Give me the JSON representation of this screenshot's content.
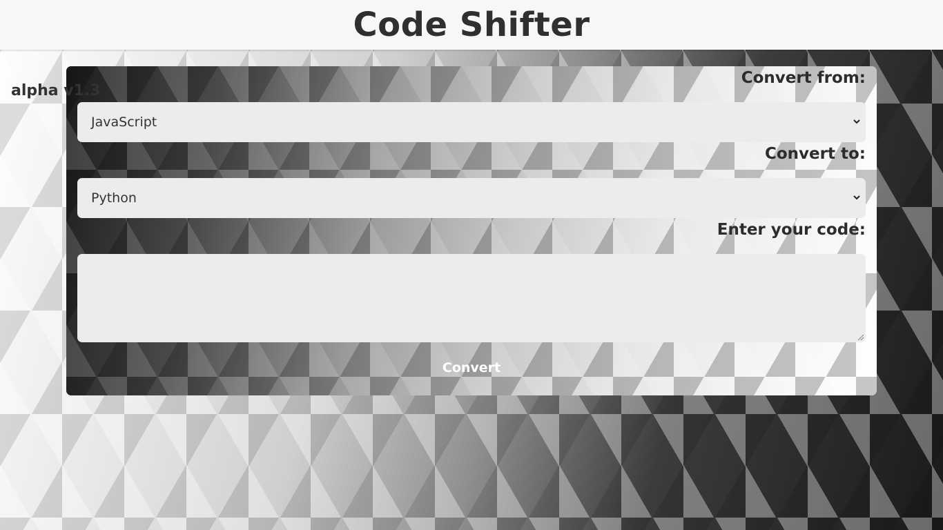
{
  "header": {
    "title": "Code Shifter"
  },
  "version_label": "alpha v1.3",
  "form": {
    "from_label": "Convert from:",
    "from_value": "JavaScript",
    "to_label": "Convert to:",
    "to_value": "Python",
    "code_label": "Enter your code:",
    "code_value": "",
    "convert_label": "Convert"
  },
  "icons": {
    "select_arrow": "chevron-down-icon",
    "resize": "resize-grip-icon"
  },
  "colors": {
    "header_bg": "#f7f7f7",
    "field_bg": "#ececec",
    "text": "#2f2f2f",
    "button_text": "#ffffff"
  }
}
